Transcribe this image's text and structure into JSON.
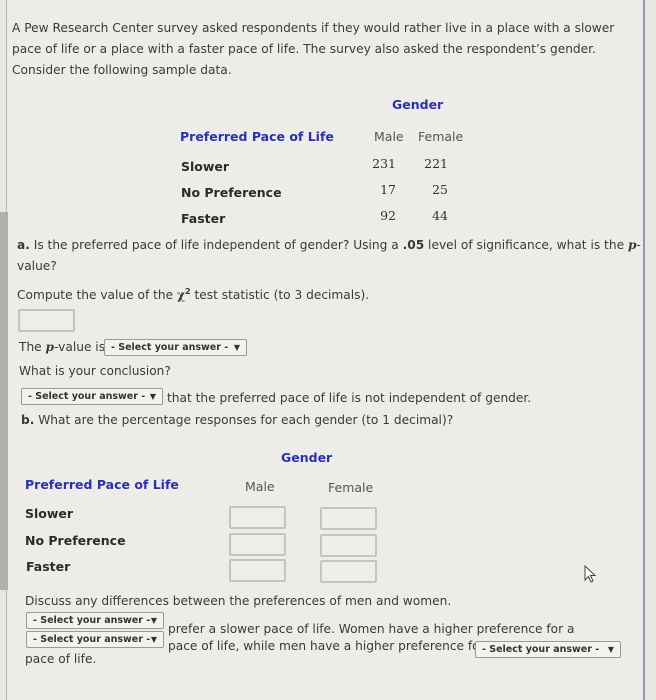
{
  "intro": "A Pew Research Center survey asked respondents if they would rather live in a place with a slower pace of life or a place with a faster pace of life. The survey also asked the respondent’s gender. Consider the following sample data.",
  "table1": {
    "gender_header": "Gender",
    "row_header": "Preferred Pace of Life",
    "columns": [
      "Male",
      "Female"
    ],
    "rows": [
      {
        "label": "Slower",
        "male": "231",
        "female": "221"
      },
      {
        "label": "No Preference",
        "male": "17",
        "female": "25"
      },
      {
        "label": "Faster",
        "male": "92",
        "female": "44"
      }
    ]
  },
  "part_a": {
    "prefix": "a.",
    "question_1": " Is the preferred pace of life independent of gender? Using a ",
    "significance": ".05",
    "question_2": " level of significance, what is the ",
    "p_letter": "p",
    "question_3": "-",
    "question_line2": "value?",
    "compute_1": "Compute the value of the ",
    "chi": "χ",
    "chi_sup": "2",
    "compute_2": " test statistic (to 3 decimals).",
    "chi_value": "",
    "pvalue_1": "The ",
    "pvalue_p": "p",
    "pvalue_2": "-value is",
    "pvalue_select": "- Select your answer -",
    "conclusion_q": "What is your conclusion?",
    "conclusion_select": "- Select your answer -",
    "conclusion_text": "that the preferred pace of life is not independent of gender."
  },
  "part_b": {
    "prefix": "b.",
    "question": " What are the percentage responses for each gender (to 1 decimal)?",
    "gender_header": "Gender",
    "row_header": "Preferred Pace of Life",
    "columns": [
      "Male",
      "Female"
    ],
    "rows": [
      {
        "label": "Slower",
        "male": "",
        "female": ""
      },
      {
        "label": "No Preference",
        "male": "",
        "female": ""
      },
      {
        "label": "Faster",
        "male": "",
        "female": ""
      }
    ],
    "discuss": "Discuss any differences between the preferences of men and women.",
    "select_1": "- Select your answer -",
    "text_1": "prefer a slower pace of life. Women have a higher preference for a",
    "select_2": "- Select your answer -",
    "text_2": "pace of life, while men have a higher preference for a",
    "select_3": "- Select your answer -",
    "text_3": "pace of life."
  },
  "icons": {
    "dropdown": "▼"
  }
}
